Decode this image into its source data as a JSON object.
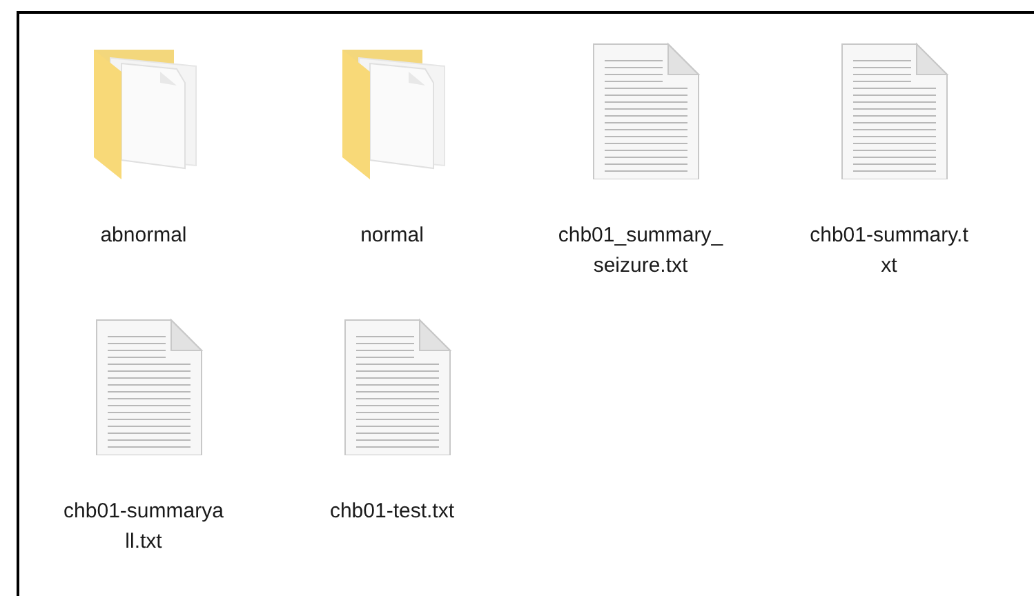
{
  "items": [
    {
      "kind": "folder",
      "lines": [
        "abnormal"
      ]
    },
    {
      "kind": "folder",
      "lines": [
        "normal"
      ]
    },
    {
      "kind": "text",
      "lines": [
        "chb01_summary_",
        "seizure.txt"
      ]
    },
    {
      "kind": "text",
      "lines": [
        "chb01-summary.t",
        "xt"
      ]
    },
    {
      "kind": "text",
      "lines": [
        "chb01-summarya",
        "ll.txt"
      ]
    },
    {
      "kind": "text",
      "lines": [
        "chb01-test.txt"
      ]
    }
  ]
}
